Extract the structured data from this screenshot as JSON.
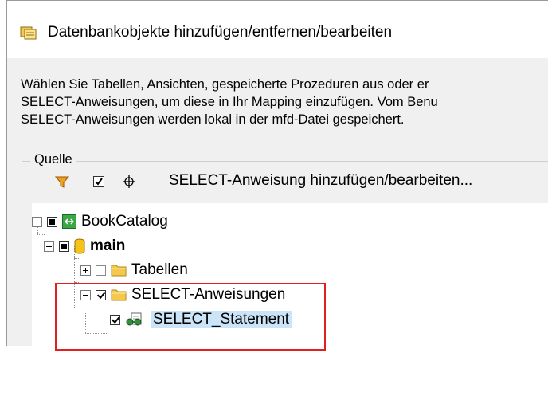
{
  "window": {
    "title": "Datenbankobjekte hinzufügen/entfernen/bearbeiten",
    "title_icon": "database-objects-icon"
  },
  "description": {
    "lines": [
      "Wählen Sie Tabellen, Ansichten, gespeicherte Prozeduren aus oder er",
      "SELECT-Anweisungen, um diese in Ihr Mapping einzufügen. Vom Benu",
      "SELECT-Anweisungen werden lokal in der mfd-Datei gespeichert."
    ]
  },
  "source_group": {
    "label": "Quelle"
  },
  "toolbar": {
    "filter_icon": "filter-icon",
    "checked_only_icon": "checkbox-icon",
    "locate_icon": "crosshair-icon",
    "select_statement_label": "SELECT-Anweisung hinzufügen/bearbeiten..."
  },
  "tree": {
    "root": {
      "label": "BookCatalog",
      "icon": "database-connection-icon",
      "check": "full"
    },
    "schema": {
      "label": "main",
      "icon": "schema-icon",
      "check": "full"
    },
    "tables": {
      "label": "Tabellen",
      "icon": "folder-icon",
      "check": "empty"
    },
    "select_statements": {
      "label": "SELECT-Anweisungen",
      "icon": "folder-icon",
      "check": "checked"
    },
    "statement": {
      "label": "SELECT_Statement",
      "icon": "select-statement-icon",
      "check": "checked"
    }
  },
  "colors": {
    "highlight_border": "#e0201c",
    "selection_bg": "#cce4f7",
    "dialog_bg": "#f0f0f0",
    "folder_yellow": "#f5c84c"
  }
}
